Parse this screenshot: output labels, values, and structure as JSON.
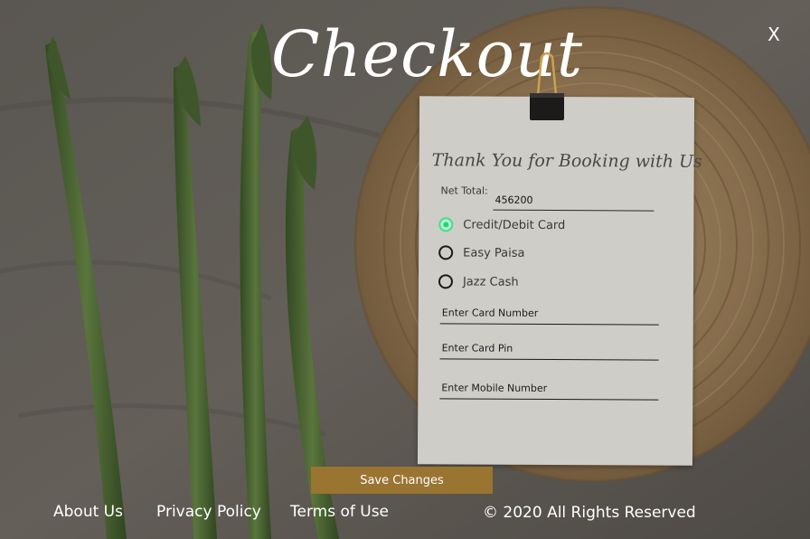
{
  "title": "Checkout",
  "close_label": "X",
  "card": {
    "heading": "Thank You for Booking with Us",
    "net_total_label": "Net Total:",
    "net_total_value": "456200",
    "payment_options": [
      {
        "label": "Credit/Debit Card",
        "selected": true
      },
      {
        "label": "Easy Paisa",
        "selected": false
      },
      {
        "label": "Jazz Cash",
        "selected": false
      }
    ],
    "fields": {
      "card_number": "Enter Card Number",
      "card_pin": "Enter Card Pin",
      "mobile_number": "Enter Mobile Number"
    }
  },
  "save_button": "Save Changes",
  "footer": {
    "links": [
      "About Us",
      "Privacy Policy",
      "Terms of Use"
    ],
    "copyright": "© 2020 All Rights Reserved"
  },
  "colors": {
    "accent_button": "#9a7431",
    "selected_radio": "#1fd673",
    "card_background": "#cfcdc8"
  }
}
